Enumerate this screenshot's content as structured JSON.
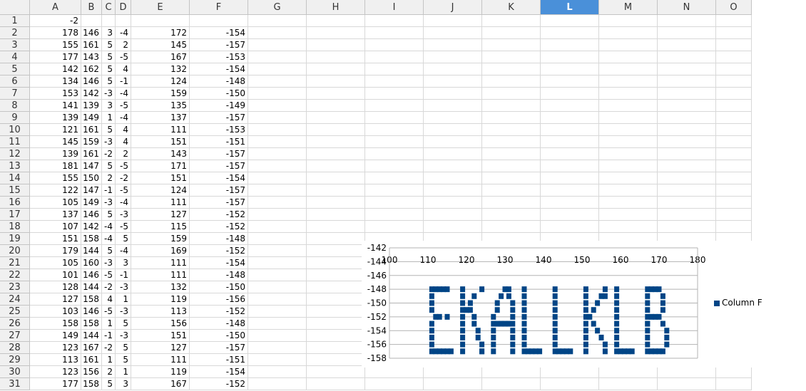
{
  "columns": [
    "A",
    "B",
    "C",
    "D",
    "E",
    "F",
    "G",
    "H",
    "I",
    "J",
    "K",
    "L",
    "M",
    "N",
    "O"
  ],
  "selected_column": "L",
  "rows": [
    [
      "-2",
      "",
      "",
      "",
      "",
      ""
    ],
    [
      "178",
      "146",
      "3",
      "-4",
      "172",
      "-154"
    ],
    [
      "155",
      "161",
      "5",
      "2",
      "145",
      "-157"
    ],
    [
      "177",
      "143",
      "5",
      "-5",
      "167",
      "-153"
    ],
    [
      "142",
      "162",
      "5",
      "4",
      "132",
      "-154"
    ],
    [
      "134",
      "146",
      "5",
      "-1",
      "124",
      "-148"
    ],
    [
      "153",
      "142",
      "-3",
      "-4",
      "159",
      "-150"
    ],
    [
      "141",
      "139",
      "3",
      "-5",
      "135",
      "-149"
    ],
    [
      "139",
      "149",
      "1",
      "-4",
      "137",
      "-157"
    ],
    [
      "121",
      "161",
      "5",
      "4",
      "111",
      "-153"
    ],
    [
      "145",
      "159",
      "-3",
      "4",
      "151",
      "-151"
    ],
    [
      "139",
      "161",
      "-2",
      "2",
      "143",
      "-157"
    ],
    [
      "181",
      "147",
      "5",
      "-5",
      "171",
      "-157"
    ],
    [
      "155",
      "150",
      "2",
      "-2",
      "151",
      "-154"
    ],
    [
      "122",
      "147",
      "-1",
      "-5",
      "124",
      "-157"
    ],
    [
      "105",
      "149",
      "-3",
      "-4",
      "111",
      "-157"
    ],
    [
      "137",
      "146",
      "5",
      "-3",
      "127",
      "-152"
    ],
    [
      "107",
      "142",
      "-4",
      "-5",
      "115",
      "-152"
    ],
    [
      "151",
      "158",
      "-4",
      "5",
      "159",
      "-148"
    ],
    [
      "179",
      "144",
      "5",
      "-4",
      "169",
      "-152"
    ],
    [
      "105",
      "160",
      "-3",
      "3",
      "111",
      "-154"
    ],
    [
      "101",
      "146",
      "-5",
      "-1",
      "111",
      "-148"
    ],
    [
      "128",
      "144",
      "-2",
      "-3",
      "132",
      "-150"
    ],
    [
      "127",
      "158",
      "4",
      "1",
      "119",
      "-156"
    ],
    [
      "103",
      "146",
      "-5",
      "-3",
      "113",
      "-152"
    ],
    [
      "158",
      "158",
      "1",
      "5",
      "156",
      "-148"
    ],
    [
      "149",
      "144",
      "-1",
      "-3",
      "151",
      "-150"
    ],
    [
      "123",
      "167",
      "-2",
      "5",
      "127",
      "-157"
    ],
    [
      "113",
      "161",
      "1",
      "5",
      "111",
      "-151"
    ],
    [
      "123",
      "156",
      "2",
      "1",
      "119",
      "-154"
    ],
    [
      "177",
      "158",
      "5",
      "3",
      "167",
      "-152"
    ]
  ],
  "chart_data": {
    "type": "scatter",
    "title": "",
    "xlabel": "",
    "ylabel": "",
    "xlim": [
      100,
      180
    ],
    "ylim": [
      -158,
      -142
    ],
    "x_ticks": [
      "100",
      "110",
      "120",
      "130",
      "140",
      "150",
      "160",
      "170",
      "180"
    ],
    "y_ticks": [
      "-142",
      "-144",
      "-146",
      "-148",
      "-150",
      "-152",
      "-154",
      "-156",
      "-158"
    ],
    "grid": true,
    "legend_position": "right",
    "marker_color": "#004586",
    "series": [
      {
        "name": "Column F",
        "points": [
          [
            172,
            -154
          ],
          [
            145,
            -157
          ],
          [
            167,
            -153
          ],
          [
            132,
            -154
          ],
          [
            124,
            -148
          ],
          [
            159,
            -150
          ],
          [
            135,
            -149
          ],
          [
            137,
            -157
          ],
          [
            111,
            -153
          ],
          [
            151,
            -151
          ],
          [
            143,
            -157
          ],
          [
            171,
            -157
          ],
          [
            151,
            -154
          ],
          [
            124,
            -157
          ],
          [
            111,
            -157
          ],
          [
            127,
            -152
          ],
          [
            115,
            -152
          ],
          [
            159,
            -148
          ],
          [
            169,
            -152
          ],
          [
            111,
            -154
          ],
          [
            111,
            -148
          ],
          [
            132,
            -150
          ],
          [
            119,
            -156
          ],
          [
            113,
            -152
          ],
          [
            156,
            -148
          ],
          [
            151,
            -150
          ],
          [
            127,
            -157
          ],
          [
            111,
            -151
          ],
          [
            119,
            -154
          ],
          [
            167,
            -152
          ],
          [
            111,
            -149
          ],
          [
            111,
            -150
          ],
          [
            111,
            -155
          ],
          [
            111,
            -156
          ],
          [
            112,
            -148
          ],
          [
            113,
            -148
          ],
          [
            114,
            -148
          ],
          [
            115,
            -148
          ],
          [
            112,
            -152
          ],
          [
            113,
            -157
          ],
          [
            114,
            -157
          ],
          [
            115,
            -157
          ],
          [
            116,
            -157
          ],
          [
            112,
            -157
          ],
          [
            119,
            -148
          ],
          [
            119,
            -149
          ],
          [
            119,
            -150
          ],
          [
            119,
            -151
          ],
          [
            119,
            -152
          ],
          [
            119,
            -153
          ],
          [
            119,
            -155
          ],
          [
            119,
            -157
          ],
          [
            120,
            -151
          ],
          [
            121,
            -151
          ],
          [
            121,
            -150
          ],
          [
            122,
            -149
          ],
          [
            122,
            -152
          ],
          [
            122,
            -153
          ],
          [
            123,
            -154
          ],
          [
            123,
            -155
          ],
          [
            124,
            -156
          ],
          [
            124,
            -157
          ],
          [
            127,
            -153
          ],
          [
            127,
            -154
          ],
          [
            127,
            -155
          ],
          [
            127,
            -156
          ],
          [
            128,
            -151
          ],
          [
            128,
            -150
          ],
          [
            129,
            -149
          ],
          [
            130,
            -148
          ],
          [
            131,
            -148
          ],
          [
            131,
            -149
          ],
          [
            132,
            -151
          ],
          [
            132,
            -152
          ],
          [
            132,
            -153
          ],
          [
            132,
            -155
          ],
          [
            132,
            -156
          ],
          [
            132,
            -157
          ],
          [
            128,
            -153
          ],
          [
            129,
            -153
          ],
          [
            130,
            -153
          ],
          [
            131,
            -153
          ],
          [
            135,
            -148
          ],
          [
            135,
            -150
          ],
          [
            135,
            -151
          ],
          [
            135,
            -152
          ],
          [
            135,
            -153
          ],
          [
            135,
            -154
          ],
          [
            135,
            -155
          ],
          [
            135,
            -156
          ],
          [
            135,
            -157
          ],
          [
            136,
            -157
          ],
          [
            138,
            -157
          ],
          [
            139,
            -157
          ],
          [
            143,
            -148
          ],
          [
            143,
            -149
          ],
          [
            143,
            -150
          ],
          [
            143,
            -151
          ],
          [
            143,
            -152
          ],
          [
            143,
            -153
          ],
          [
            143,
            -154
          ],
          [
            143,
            -155
          ],
          [
            143,
            -156
          ],
          [
            144,
            -157
          ],
          [
            146,
            -157
          ],
          [
            147,
            -157
          ],
          [
            151,
            -148
          ],
          [
            151,
            -149
          ],
          [
            151,
            -152
          ],
          [
            151,
            -153
          ],
          [
            151,
            -155
          ],
          [
            151,
            -156
          ],
          [
            151,
            -157
          ],
          [
            152,
            -152
          ],
          [
            153,
            -151
          ],
          [
            154,
            -150
          ],
          [
            155,
            -149
          ],
          [
            156,
            -149
          ],
          [
            153,
            -153
          ],
          [
            154,
            -154
          ],
          [
            155,
            -155
          ],
          [
            156,
            -156
          ],
          [
            156,
            -157
          ],
          [
            159,
            -149
          ],
          [
            159,
            -151
          ],
          [
            159,
            -152
          ],
          [
            159,
            -153
          ],
          [
            159,
            -154
          ],
          [
            159,
            -155
          ],
          [
            159,
            -156
          ],
          [
            159,
            -157
          ],
          [
            160,
            -157
          ],
          [
            161,
            -157
          ],
          [
            162,
            -157
          ],
          [
            163,
            -157
          ],
          [
            167,
            -148
          ],
          [
            167,
            -149
          ],
          [
            167,
            -150
          ],
          [
            167,
            -151
          ],
          [
            167,
            -153
          ],
          [
            167,
            -154
          ],
          [
            167,
            -155
          ],
          [
            167,
            -156
          ],
          [
            167,
            -157
          ],
          [
            168,
            -148
          ],
          [
            169,
            -148
          ],
          [
            170,
            -148
          ],
          [
            171,
            -149
          ],
          [
            171,
            -150
          ],
          [
            171,
            -151
          ],
          [
            168,
            -152
          ],
          [
            170,
            -152
          ],
          [
            171,
            -153
          ],
          [
            172,
            -155
          ],
          [
            172,
            -156
          ],
          [
            168,
            -157
          ],
          [
            169,
            -157
          ],
          [
            170,
            -157
          ]
        ]
      }
    ]
  }
}
